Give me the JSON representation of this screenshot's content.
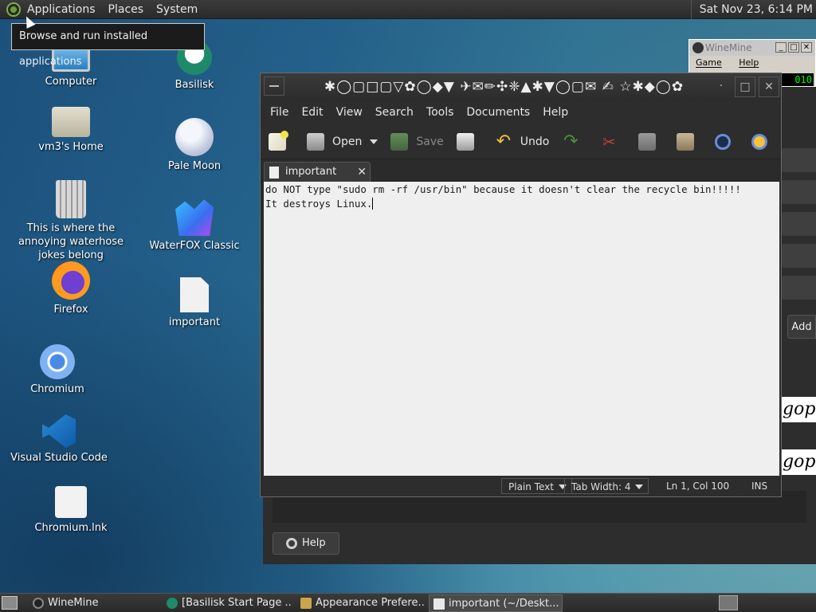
{
  "top_panel": {
    "menus": [
      "Applications",
      "Places",
      "System"
    ],
    "clock": "Sat Nov 23,  6:14 PM",
    "tooltip": "Browse and run installed applications"
  },
  "desktop_icons": [
    {
      "label": "Computer",
      "icon": "computer-icon"
    },
    {
      "label": "vm3's Home",
      "icon": "home-folder-icon"
    },
    {
      "label": "This is where the annoying waterhose jokes belong",
      "icon": "trash-icon"
    },
    {
      "label": "Firefox",
      "icon": "firefox-icon"
    },
    {
      "label": "Chromium",
      "icon": "chromium-icon"
    },
    {
      "label": "Visual Studio Code",
      "icon": "vscode-icon"
    },
    {
      "label": "Chromium.lnk",
      "icon": "shortcut-icon"
    },
    {
      "label": "Basilisk",
      "icon": "basilisk-icon"
    },
    {
      "label": "Pale Moon",
      "icon": "palemoon-icon"
    },
    {
      "label": "WaterFOX Classic",
      "icon": "waterfox-icon"
    },
    {
      "label": "important",
      "icon": "text-file-icon"
    }
  ],
  "winemine": {
    "title": "WineMine",
    "menus": [
      "Game",
      "Help"
    ],
    "counter": "010"
  },
  "background_window": {
    "add_label": "Add",
    "help_label": "Help",
    "font_sample": "gop"
  },
  "gedit": {
    "title": "✱◯▢□▢▽✿◯◆▼ ✈✉✏✣❈▲✱▼◯▢✉ ✍ ☆✱◆◯✿",
    "menus": [
      "File",
      "Edit",
      "View",
      "Search",
      "Tools",
      "Documents",
      "Help"
    ],
    "toolbar": {
      "open": "Open",
      "save": "Save",
      "undo": "Undo"
    },
    "tab_label": "important",
    "content_line1": "do NOT type \"sudo rm -rf /usr/bin\" because it doesn't clear the recycle bin!!!!!",
    "content_line2": "It destroys Linux.",
    "status": {
      "syntax": "Plain Text",
      "tab_width": "Tab Width:  4",
      "position": "Ln 1, Col 100",
      "mode": "INS"
    }
  },
  "taskbar": [
    {
      "label": "WineMine",
      "active": false
    },
    {
      "label": "[Basilisk Start Page ...",
      "active": false
    },
    {
      "label": "Appearance Prefere...",
      "active": false
    },
    {
      "label": "important (~/Deskt...",
      "active": true
    }
  ]
}
